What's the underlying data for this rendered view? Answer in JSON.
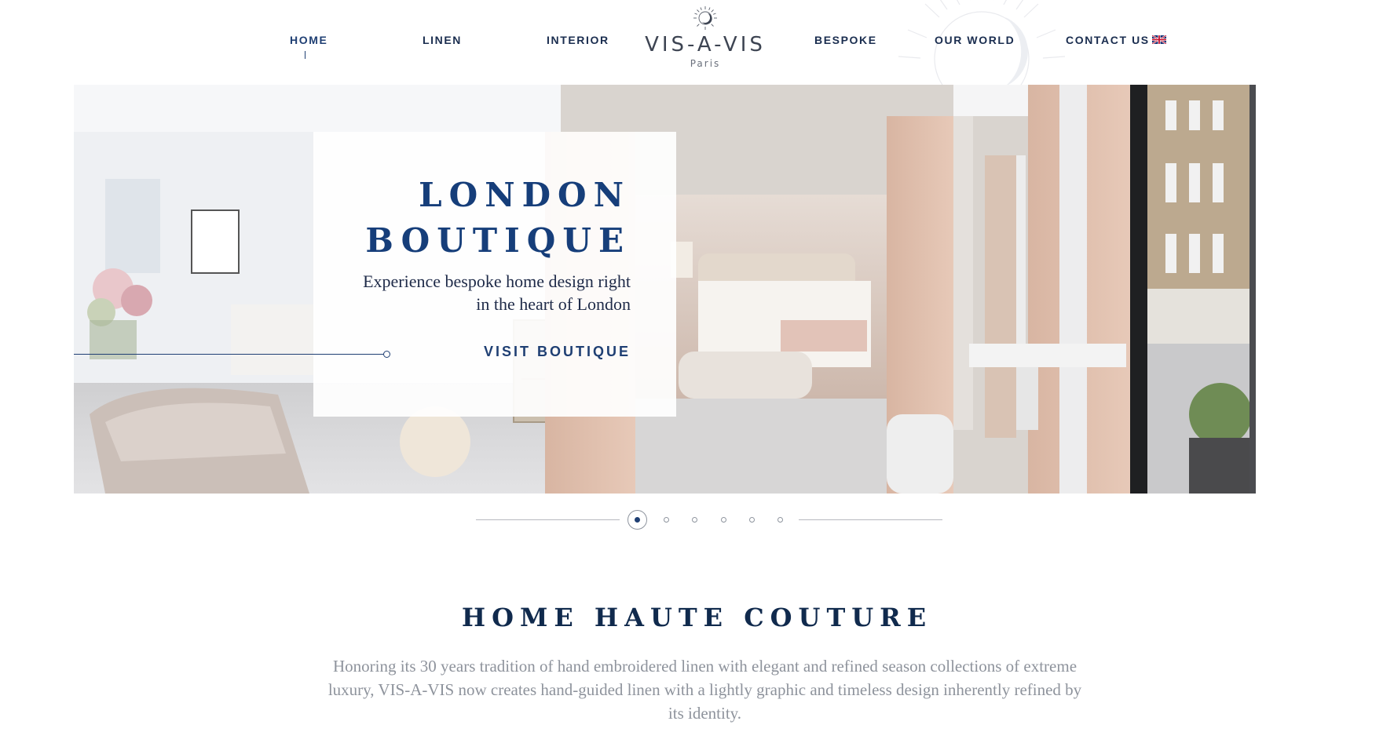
{
  "nav": {
    "items": [
      {
        "label": "HOME",
        "active": true
      },
      {
        "label": "LINEN"
      },
      {
        "label": "INTERIOR"
      },
      {
        "label": "BESPOKE"
      },
      {
        "label": "OUR WORLD"
      },
      {
        "label": "CONTACT US"
      }
    ],
    "language_icon": "uk-flag-icon"
  },
  "logo": {
    "brand": "VIS-A-VIS",
    "city": "Paris",
    "emblem_icon": "moon-emblem-icon"
  },
  "hero": {
    "title_line1": "LONDON",
    "title_line2": "BOUTIQUE",
    "subtitle_line1": "Experience bespoke home design right",
    "subtitle_line2": "in the heart of London",
    "cta_label": "VISIT BOUTIQUE"
  },
  "slider": {
    "slide_count": 6,
    "active_index": 0
  },
  "intro": {
    "title": "HOME HAUTE COUTURE",
    "line1": "Honoring its 30 years tradition of hand embroidered linen with elegant and refined season collections of extreme",
    "line2": "luxury, VIS-A-VIS now creates hand-guided linen with a lightly graphic and timeless design inherently refined by",
    "line3": "its identity."
  },
  "colors": {
    "navy": "#1f3f73",
    "title_navy": "#102a4d",
    "body_grey": "#8e939c"
  }
}
